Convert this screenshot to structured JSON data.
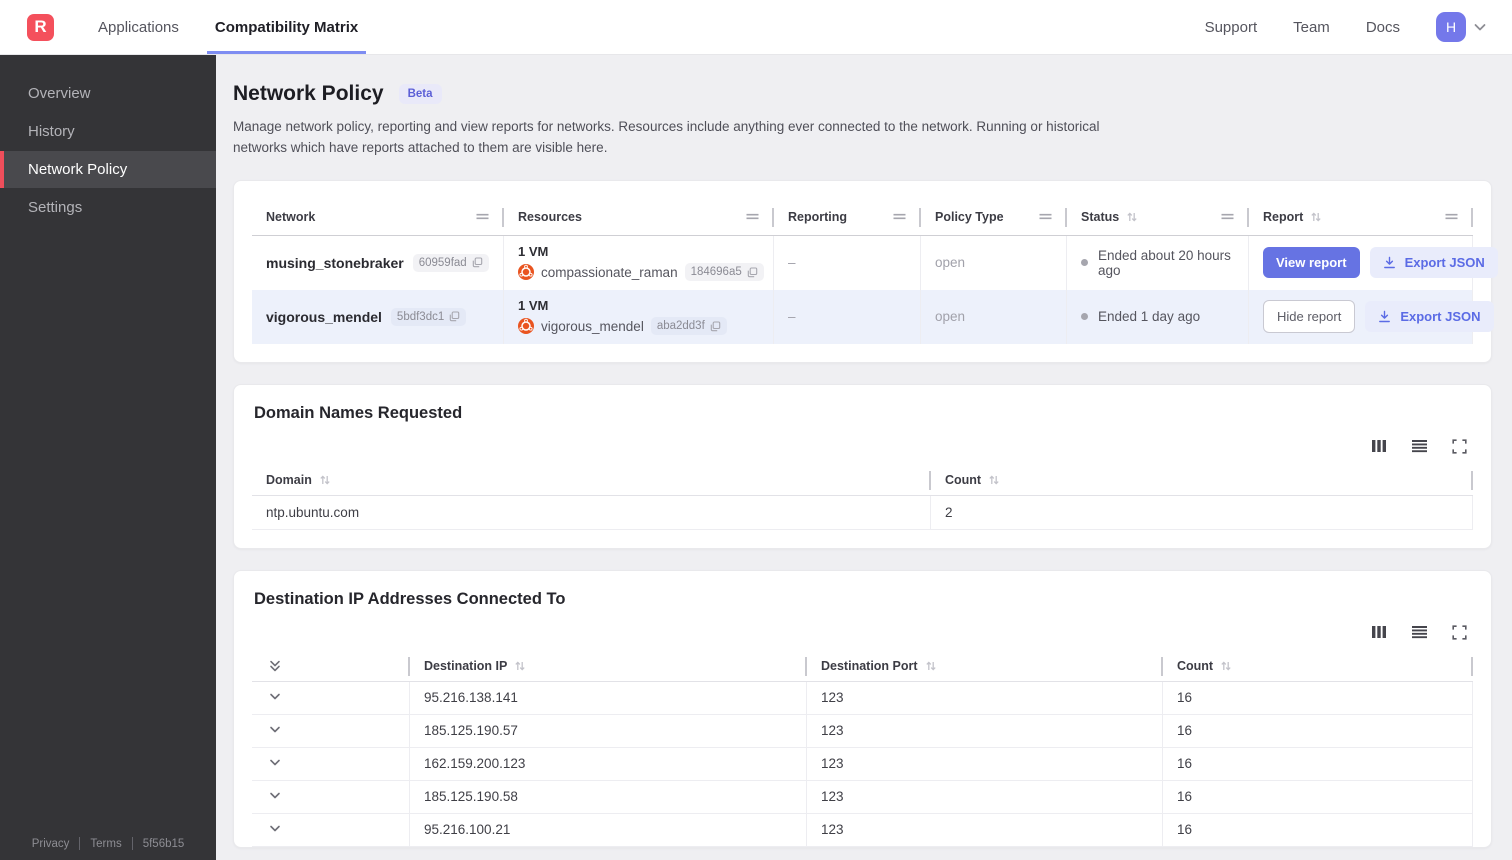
{
  "navbar": {
    "logo_letter": "R",
    "tabs": [
      {
        "label": "Applications"
      },
      {
        "label": "Compatibility Matrix"
      }
    ],
    "links": [
      {
        "label": "Support"
      },
      {
        "label": "Team"
      },
      {
        "label": "Docs"
      }
    ],
    "avatar_initial": "H"
  },
  "sidebar": {
    "items": [
      {
        "label": "Overview"
      },
      {
        "label": "History"
      },
      {
        "label": "Network Policy"
      },
      {
        "label": "Settings"
      }
    ],
    "footer": {
      "privacy": "Privacy",
      "terms": "Terms",
      "build": "5f56b15"
    }
  },
  "page": {
    "title": "Network Policy",
    "badge": "Beta",
    "description": "Manage network policy, reporting and view reports for networks. Resources include anything ever connected to the network. Running or historical networks which have reports attached to them are visible here."
  },
  "networks_table": {
    "headers": [
      {
        "label": "Network"
      },
      {
        "label": "Resources"
      },
      {
        "label": "Reporting"
      },
      {
        "label": "Policy Type"
      },
      {
        "label": "Status"
      },
      {
        "label": "Report"
      }
    ],
    "rows": [
      {
        "name": "musing_stonebraker",
        "id": "60959fad",
        "vm_count": "1 VM",
        "vm_name": "compassionate_raman",
        "vm_id": "184696a5",
        "reporting": "–",
        "policy_type": "open",
        "status": "Ended about 20 hours ago",
        "report_button": "View report",
        "export_label": "Export JSON"
      },
      {
        "name": "vigorous_mendel",
        "id": "5bdf3dc1",
        "vm_count": "1 VM",
        "vm_name": "vigorous_mendel",
        "vm_id": "aba2dd3f",
        "reporting": "–",
        "policy_type": "open",
        "status": "Ended 1 day ago",
        "report_button": "Hide report",
        "export_label": "Export JSON"
      }
    ]
  },
  "domains_card": {
    "title": "Domain Names Requested",
    "headers": [
      {
        "label": "Domain"
      },
      {
        "label": "Count"
      }
    ],
    "rows": [
      {
        "domain": "ntp.ubuntu.com",
        "count": "2"
      }
    ]
  },
  "destinations_card": {
    "title": "Destination IP Addresses Connected To",
    "headers": [
      {
        "label": "Destination IP"
      },
      {
        "label": "Destination Port"
      },
      {
        "label": "Count"
      }
    ],
    "rows": [
      {
        "ip": "95.216.138.141",
        "port": "123",
        "count": "16"
      },
      {
        "ip": "185.125.190.57",
        "port": "123",
        "count": "16"
      },
      {
        "ip": "162.159.200.123",
        "port": "123",
        "count": "16"
      },
      {
        "ip": "185.125.190.58",
        "port": "123",
        "count": "16"
      },
      {
        "ip": "95.216.100.21",
        "port": "123",
        "count": "16"
      }
    ]
  },
  "icons": {
    "drag_handle": "double-horizontal-lines",
    "sort": "up-down-arrows",
    "copy": "duplicate-squares",
    "download": "arrow-into-tray",
    "columns_view": "three-vertical-bars",
    "rows_view": "horizontal-lines",
    "fullscreen": "corner-brackets",
    "vm_os": "ubuntu-logo"
  },
  "colors": {
    "brand_red": "#f4505c",
    "sidebar_accent": "#ef4e5b",
    "tab_underline": "#7e8df2",
    "primary_button": "#6673e3",
    "soft_button_bg": "#e9ecfb",
    "selected_row": "#edf1fb",
    "ubuntu_orange": "#e95420",
    "beta_badge_bg": "#e9e9f9"
  }
}
